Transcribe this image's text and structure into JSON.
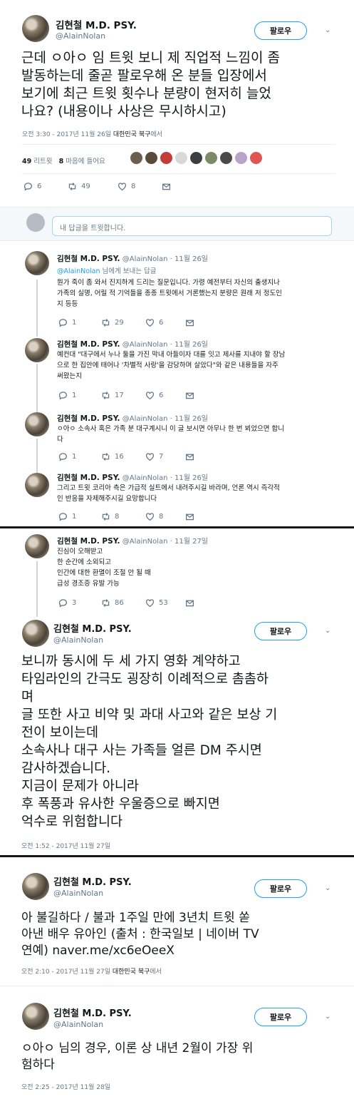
{
  "colors": {
    "accent": "#1da1f2",
    "muted": "#657786",
    "text": "#14171a",
    "divider": "#14171a"
  },
  "t1": {
    "name": "김현철 M.D. PSY.",
    "handle": "@AlainNolan",
    "follow": "팔로우",
    "text": "근데 ㅇ아ㅇ 임 트윗 보니 제 직업적 느낌이 좀\n발동하는데 줄곧 팔로우해 온 분들 입장에서\n보기에 최근 트윗 횟수나 분량이 현저히 늘었\n나요? (내용이나 사상은 무시하시고)",
    "time": "오전 3:30 - 2017년 11월 26일 ",
    "location": "대한민국 북구",
    "location_suffix": "에서",
    "retweets_num": "49",
    "retweets_label": "리트윗",
    "likes_num": "8",
    "likes_label": "마음에 들어요",
    "reply_count": "6",
    "rt_count": "49",
    "like_count": "8"
  },
  "composer": {
    "placeholder": "내 답글을 트윗합니다."
  },
  "replies": [
    {
      "name": "김현철 M.D. PSY.",
      "meta": "@AlainNolan · 11월 26일",
      "reply_to": "@AlainNolan",
      "reply_to_suffix": " 님에게 보내는 답글",
      "text": "뭔가 죽이 좀 와서 진지하게 드리는 질문입니다. 가령 예전부터 자신의 출생지나\n가족의 실명, 어릴 적 기억들을 종종 트윗에서 거론했는지 분량은 원래 저 정도인\n지 등등",
      "reply": "1",
      "rt": "29",
      "like": "6"
    },
    {
      "name": "김현철 M.D. PSY.",
      "meta": "@AlainNolan · 11월 26일",
      "text": "예컨대 \"대구에서 누나 둘을 가진 막내 아들이자 대를 잇고 제사를 지내야 할 장남\n으로 한 집안에 태어나 '차별적 사랑'을 감당하며 살았다\"와 같은 내용들을 자주\n써왔는지",
      "reply": "1",
      "rt": "17",
      "like": "6"
    },
    {
      "name": "김현철 M.D. PSY.",
      "meta": "@AlainNolan · 11월 26일",
      "text": "ㅇ아ㅇ 소속사 혹은 가족 분 대구계시니 이 글 보시면 아무나 한 번 뵈었으면 합니\n다",
      "reply": "1",
      "rt": "16",
      "like": "7"
    },
    {
      "name": "김현철 M.D. PSY.",
      "meta": "@AlainNolan · 11월 26일",
      "text": "그리고 트윗 코리아 측은 가급적 실트에서 내려주시길 바라며, 언론 역시 즉각적\n인 반응을 자제해주시길 요망합니다",
      "reply": "1",
      "rt": "8",
      "like": "8"
    }
  ],
  "p2": {
    "reply": {
      "name": "김현철 M.D. PSY.",
      "meta": "@AlainNolan · 11월 27일",
      "text": "진심이 오해받고\n한 순간에 소외되고\n인간에 대한 환멸이 조절 안 될 때\n급성 경조증 유발 가능",
      "reply": "3",
      "rt": "86",
      "like": "53"
    },
    "tweet": {
      "name": "김현철 M.D. PSY.",
      "handle": "@AlainNolan",
      "follow": "팔로우",
      "text": "보니까 동시에 두 세 가지 영화 계약하고\n타임라인의 간극도 굉장히 이례적으로 촘촘하\n며\n글 또한 사고 비약 및 과대 사고와 같은 보상 기\n전이 보이는데\n소속사나 대구 사는 가족들 얼른 DM 주시면\n감사하겠습니다.\n지금이 문제가 아니라\n후 폭풍과 유사한 우울증으로 빠지면\n억수로 위험합니다",
      "time": "오전 1:52 - 2017년 11월 27일"
    }
  },
  "p3": {
    "name": "김현철 M.D. PSY.",
    "handle": "@AlainNolan",
    "follow": "팔로우",
    "text": "아 불길하다 / 불과 1주일 만에 3년치 트윗 쏟\n아낸 배우 유아인 (출처 : 한국일보 | 네이버 TV\n연예) naver.me/xc6eOeeX",
    "time": "오전 2:10 - 2017년 11월 27일 ",
    "location": "대한민국 북구",
    "location_suffix": "에서"
  },
  "p4": {
    "name": "김현철 M.D. PSY.",
    "handle": "@AlainNolan",
    "follow": "팔로우",
    "text": "ㅇ아ㅇ 님의 경우, 이론 상 내년 2월이 가장 위\n험하다",
    "time": "오전 2:25 - 2017년 11월 28일"
  }
}
